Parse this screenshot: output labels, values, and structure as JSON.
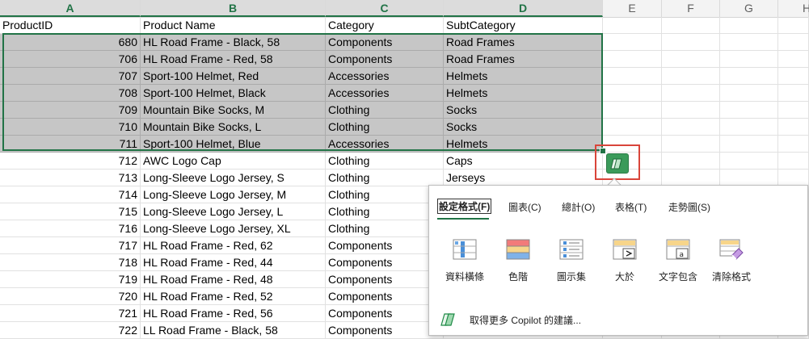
{
  "columns": [
    "A",
    "B",
    "C",
    "D",
    "E",
    "F",
    "G",
    "H"
  ],
  "headers": [
    "ProductID",
    "Product Name",
    "Category",
    "SubtCategory"
  ],
  "rows": [
    [
      "680",
      "HL Road Frame - Black, 58",
      "Components",
      "Road Frames"
    ],
    [
      "706",
      "HL Road Frame - Red, 58",
      "Components",
      "Road Frames"
    ],
    [
      "707",
      "Sport-100 Helmet, Red",
      "Accessories",
      "Helmets"
    ],
    [
      "708",
      "Sport-100 Helmet, Black",
      "Accessories",
      "Helmets"
    ],
    [
      "709",
      "Mountain Bike Socks, M",
      "Clothing",
      "Socks"
    ],
    [
      "710",
      "Mountain Bike Socks, L",
      "Clothing",
      "Socks"
    ],
    [
      "711",
      "Sport-100 Helmet, Blue",
      "Accessories",
      "Helmets"
    ],
    [
      "712",
      "AWC Logo Cap",
      "Clothing",
      "Caps"
    ],
    [
      "713",
      "Long-Sleeve Logo Jersey, S",
      "Clothing",
      "Jerseys"
    ],
    [
      "714",
      "Long-Sleeve Logo Jersey, M",
      "Clothing",
      ""
    ],
    [
      "715",
      "Long-Sleeve Logo Jersey, L",
      "Clothing",
      ""
    ],
    [
      "716",
      "Long-Sleeve Logo Jersey, XL",
      "Clothing",
      ""
    ],
    [
      "717",
      "HL Road Frame - Red, 62",
      "Components",
      ""
    ],
    [
      "718",
      "HL Road Frame - Red, 44",
      "Components",
      ""
    ],
    [
      "719",
      "HL Road Frame - Red, 48",
      "Components",
      ""
    ],
    [
      "720",
      "HL Road Frame - Red, 52",
      "Components",
      ""
    ],
    [
      "721",
      "HL Road Frame - Red, 56",
      "Components",
      ""
    ],
    [
      "722",
      "LL Road Frame - Black, 58",
      "Components",
      ""
    ]
  ],
  "selected_rows": 7,
  "popup": {
    "tabs": [
      "設定格式(F)",
      "圖表(C)",
      "總計(O)",
      "表格(T)",
      "走勢圖(S)"
    ],
    "tools": [
      {
        "label": "資料橫條",
        "icon": "data-bars-icon"
      },
      {
        "label": "色階",
        "icon": "color-scale-icon"
      },
      {
        "label": "圖示集",
        "icon": "icon-set-icon"
      },
      {
        "label": "大於",
        "icon": "greater-than-icon"
      },
      {
        "label": "文字包含",
        "icon": "text-contains-icon"
      },
      {
        "label": "清除格式",
        "icon": "clear-format-icon"
      }
    ],
    "more_label": "取得更多 Copilot 的建議..."
  },
  "colors": {
    "accent": "#217346",
    "highlight": "#d9453a",
    "selection": "#c6c6c6"
  }
}
